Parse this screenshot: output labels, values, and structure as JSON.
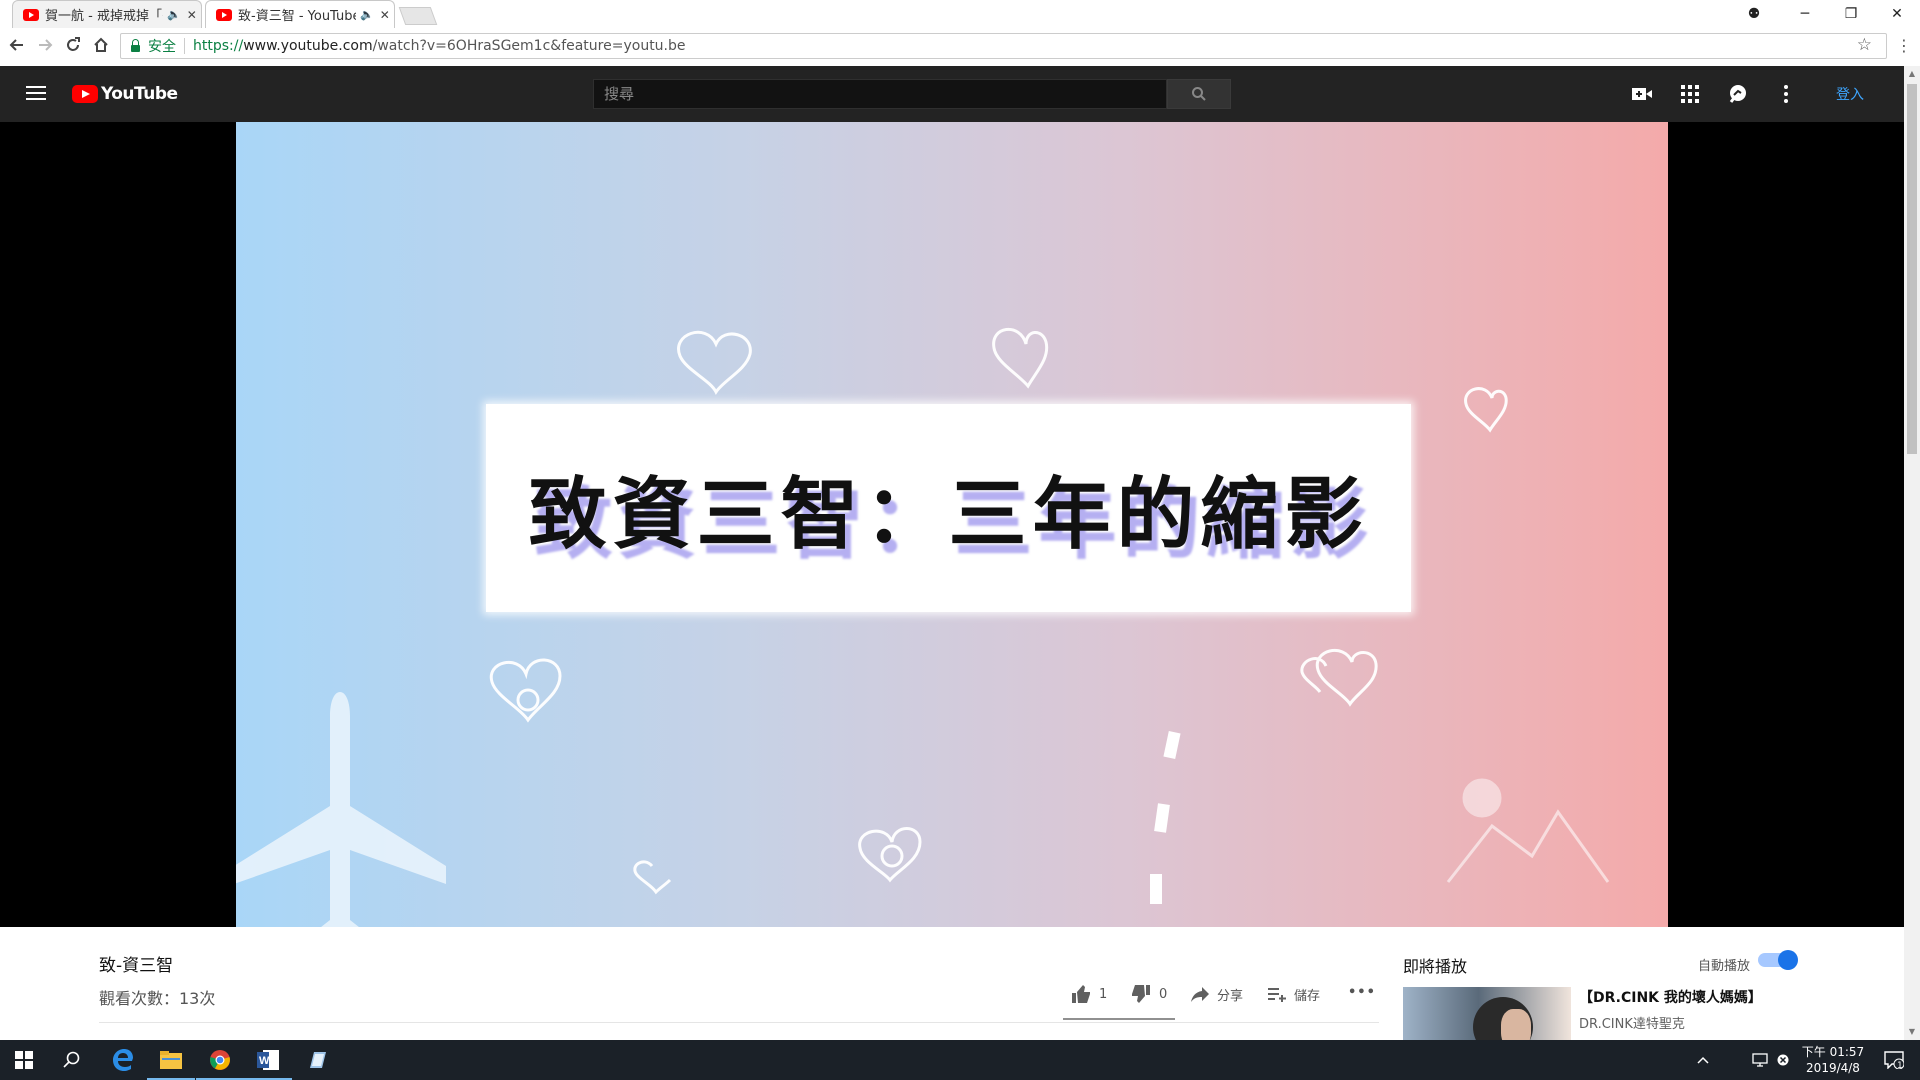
{
  "browser": {
    "tabs": [
      {
        "title": "賀一航 - 戒掉戒掉「丟",
        "audio": "🔈",
        "close": "✕"
      },
      {
        "title": "致-資三智 - YouTube",
        "audio": "🔈",
        "close": "✕"
      }
    ],
    "window_controls": {
      "account": "⚉",
      "minimize": "─",
      "restore": "❐",
      "close": "✕"
    },
    "security_label": "安全",
    "url_scheme": "https://",
    "url_host": "www.youtube.com",
    "url_path": "/watch?v=6OHraSGem1c&feature=youtu.be"
  },
  "masthead": {
    "logo_text": "YouTube",
    "search_placeholder": "搜尋",
    "signin_label": "登入",
    "icons": [
      "create-video-icon",
      "apps-grid-icon",
      "messages-icon",
      "settings-dots-icon"
    ]
  },
  "video": {
    "title_card_text": "致資三智：三年的縮影"
  },
  "info": {
    "title": "致-資三智",
    "views": "觀看次數：13次",
    "likes": "1",
    "dislikes": "0",
    "share_label": "分享",
    "save_label": "儲存",
    "more_label": "•••"
  },
  "sidebar": {
    "up_next": "即將播放",
    "autoplay": "自動播放",
    "autoplay_on": true,
    "rec_title": "【DR.CINK 我的壞人媽媽】",
    "rec_channel": "DR.CINK達特聖克"
  },
  "taskbar": {
    "time_line1": "下午 01:57",
    "time_line2": "2019/4/8",
    "notif_count": "1",
    "apps": [
      "windows-start-icon",
      "search-icon",
      "edge-icon",
      "file-explorer-icon",
      "chrome-icon",
      "word-icon",
      "notepad-icon"
    ]
  },
  "colors": {
    "masthead_bg": "#232323",
    "youtube_red": "#ff0000",
    "link_blue": "#3ea6ff",
    "secure_green": "#0b8043",
    "taskbar_bg": "#1b2128"
  }
}
